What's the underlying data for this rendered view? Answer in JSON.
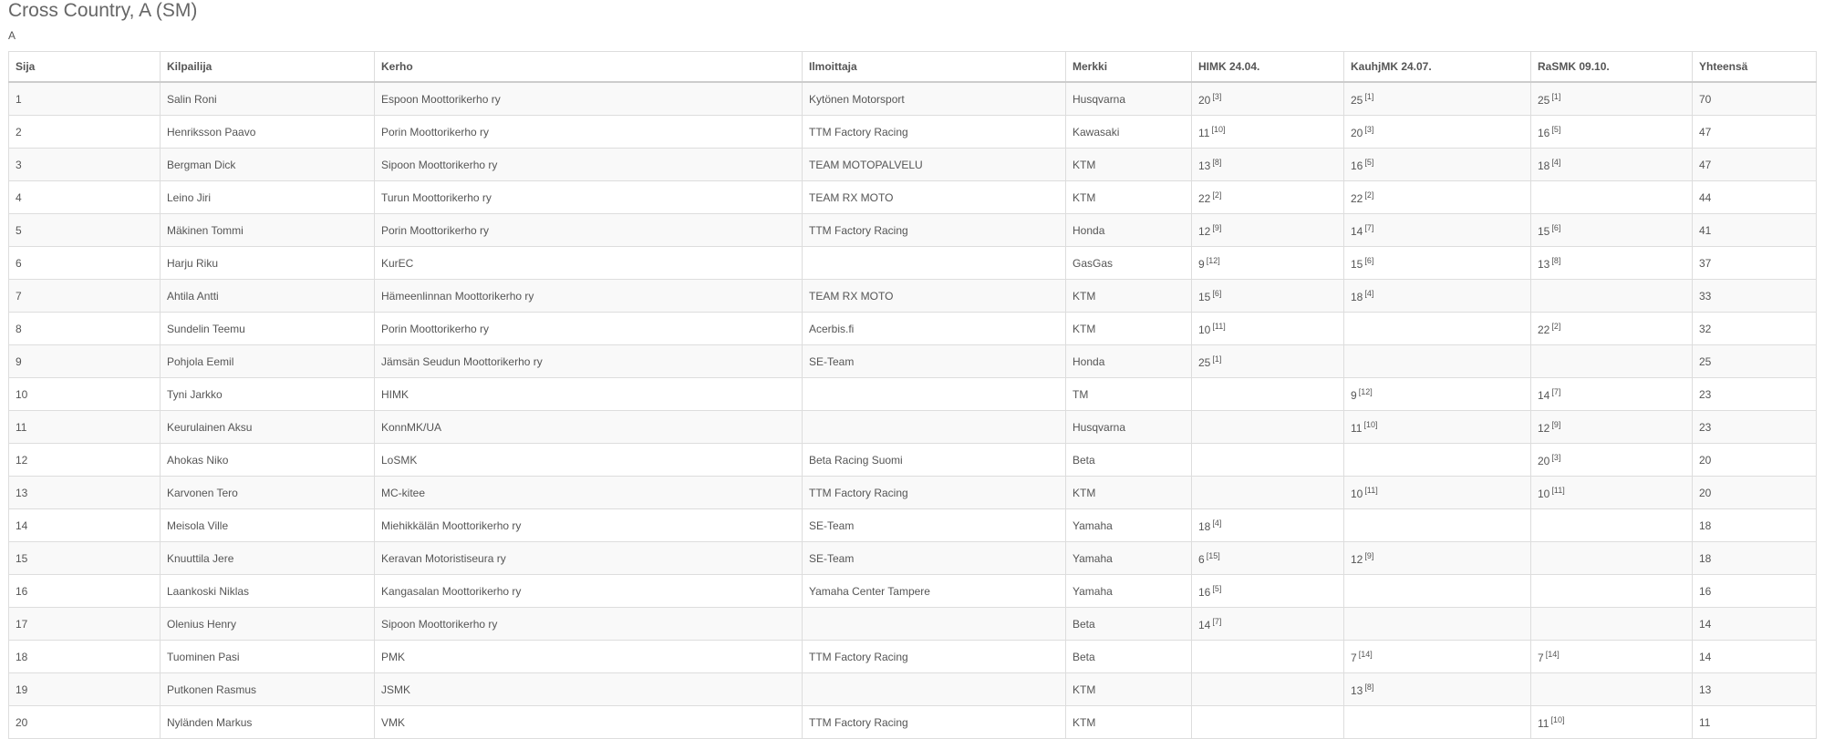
{
  "page": {
    "title": "Cross Country, A (SM)",
    "class_label": "A"
  },
  "table": {
    "headers": [
      "Sija",
      "Kilpailija",
      "Kerho",
      "Ilmoittaja",
      "Merkki",
      "HIMK 24.04.",
      "KauhjMK 24.07.",
      "RaSMK 09.10.",
      "Yhteensä"
    ],
    "rows": [
      {
        "rank": "1",
        "name": "Salin Roni",
        "club": "Espoon Moottorikerho ry",
        "entrant": "Kytönen Motorsport",
        "brand": "Husqvarna",
        "r1": {
          "pts": "20",
          "pos": "[3]"
        },
        "r2": {
          "pts": "25",
          "pos": "[1]"
        },
        "r3": {
          "pts": "25",
          "pos": "[1]"
        },
        "total": "70"
      },
      {
        "rank": "2",
        "name": "Henriksson Paavo",
        "club": "Porin Moottorikerho ry",
        "entrant": "TTM Factory Racing",
        "brand": "Kawasaki",
        "r1": {
          "pts": "11",
          "pos": "[10]"
        },
        "r2": {
          "pts": "20",
          "pos": "[3]"
        },
        "r3": {
          "pts": "16",
          "pos": "[5]"
        },
        "total": "47"
      },
      {
        "rank": "3",
        "name": "Bergman Dick",
        "club": "Sipoon Moottorikerho ry",
        "entrant": "TEAM MOTOPALVELU",
        "brand": "KTM",
        "r1": {
          "pts": "13",
          "pos": "[8]"
        },
        "r2": {
          "pts": "16",
          "pos": "[5]"
        },
        "r3": {
          "pts": "18",
          "pos": "[4]"
        },
        "total": "47"
      },
      {
        "rank": "4",
        "name": "Leino Jiri",
        "club": "Turun Moottorikerho ry",
        "entrant": "TEAM RX MOTO",
        "brand": "KTM",
        "r1": {
          "pts": "22",
          "pos": "[2]"
        },
        "r2": {
          "pts": "22",
          "pos": "[2]"
        },
        "r3": {
          "pts": "",
          "pos": ""
        },
        "total": "44"
      },
      {
        "rank": "5",
        "name": "Mäkinen Tommi",
        "club": "Porin Moottorikerho ry",
        "entrant": "TTM Factory Racing",
        "brand": "Honda",
        "r1": {
          "pts": "12",
          "pos": "[9]"
        },
        "r2": {
          "pts": "14",
          "pos": "[7]"
        },
        "r3": {
          "pts": "15",
          "pos": "[6]"
        },
        "total": "41"
      },
      {
        "rank": "6",
        "name": "Harju Riku",
        "club": "KurEC",
        "entrant": "",
        "brand": "GasGas",
        "r1": {
          "pts": "9",
          "pos": "[12]"
        },
        "r2": {
          "pts": "15",
          "pos": "[6]"
        },
        "r3": {
          "pts": "13",
          "pos": "[8]"
        },
        "total": "37"
      },
      {
        "rank": "7",
        "name": "Ahtila Antti",
        "club": "Hämeenlinnan Moottorikerho ry",
        "entrant": "TEAM RX MOTO",
        "brand": "KTM",
        "r1": {
          "pts": "15",
          "pos": "[6]"
        },
        "r2": {
          "pts": "18",
          "pos": "[4]"
        },
        "r3": {
          "pts": "",
          "pos": ""
        },
        "total": "33"
      },
      {
        "rank": "8",
        "name": "Sundelin Teemu",
        "club": "Porin Moottorikerho ry",
        "entrant": "Acerbis.fi",
        "brand": "KTM",
        "r1": {
          "pts": "10",
          "pos": "[11]"
        },
        "r2": {
          "pts": "",
          "pos": ""
        },
        "r3": {
          "pts": "22",
          "pos": "[2]"
        },
        "total": "32"
      },
      {
        "rank": "9",
        "name": "Pohjola Eemil",
        "club": "Jämsän Seudun Moottorikerho ry",
        "entrant": "SE-Team",
        "brand": "Honda",
        "r1": {
          "pts": "25",
          "pos": "[1]"
        },
        "r2": {
          "pts": "",
          "pos": ""
        },
        "r3": {
          "pts": "",
          "pos": ""
        },
        "total": "25"
      },
      {
        "rank": "10",
        "name": "Tyni Jarkko",
        "club": "HIMK",
        "entrant": "",
        "brand": "TM",
        "r1": {
          "pts": "",
          "pos": ""
        },
        "r2": {
          "pts": "9",
          "pos": "[12]"
        },
        "r3": {
          "pts": "14",
          "pos": "[7]"
        },
        "total": "23"
      },
      {
        "rank": "11",
        "name": "Keurulainen Aksu",
        "club": "KonnMK/UA",
        "entrant": "",
        "brand": "Husqvarna",
        "r1": {
          "pts": "",
          "pos": ""
        },
        "r2": {
          "pts": "11",
          "pos": "[10]"
        },
        "r3": {
          "pts": "12",
          "pos": "[9]"
        },
        "total": "23"
      },
      {
        "rank": "12",
        "name": "Ahokas Niko",
        "club": "LoSMK",
        "entrant": "Beta Racing Suomi",
        "brand": "Beta",
        "r1": {
          "pts": "",
          "pos": ""
        },
        "r2": {
          "pts": "",
          "pos": ""
        },
        "r3": {
          "pts": "20",
          "pos": "[3]"
        },
        "total": "20"
      },
      {
        "rank": "13",
        "name": "Karvonen Tero",
        "club": "MC-kitee",
        "entrant": "TTM Factory Racing",
        "brand": "KTM",
        "r1": {
          "pts": "",
          "pos": ""
        },
        "r2": {
          "pts": "10",
          "pos": "[11]"
        },
        "r3": {
          "pts": "10",
          "pos": "[11]"
        },
        "total": "20"
      },
      {
        "rank": "14",
        "name": "Meisola Ville",
        "club": "Miehikkälän Moottorikerho ry",
        "entrant": "SE-Team",
        "brand": "Yamaha",
        "r1": {
          "pts": "18",
          "pos": "[4]"
        },
        "r2": {
          "pts": "",
          "pos": ""
        },
        "r3": {
          "pts": "",
          "pos": ""
        },
        "total": "18"
      },
      {
        "rank": "15",
        "name": "Knuuttila Jere",
        "club": "Keravan Motoristiseura ry",
        "entrant": "SE-Team",
        "brand": "Yamaha",
        "r1": {
          "pts": "6",
          "pos": "[15]"
        },
        "r2": {
          "pts": "12",
          "pos": "[9]"
        },
        "r3": {
          "pts": "",
          "pos": ""
        },
        "total": "18"
      },
      {
        "rank": "16",
        "name": "Laankoski Niklas",
        "club": "Kangasalan Moottorikerho ry",
        "entrant": "Yamaha Center Tampere",
        "brand": "Yamaha",
        "r1": {
          "pts": "16",
          "pos": "[5]"
        },
        "r2": {
          "pts": "",
          "pos": ""
        },
        "r3": {
          "pts": "",
          "pos": ""
        },
        "total": "16"
      },
      {
        "rank": "17",
        "name": "Olenius Henry",
        "club": "Sipoon Moottorikerho ry",
        "entrant": "",
        "brand": "Beta",
        "r1": {
          "pts": "14",
          "pos": "[7]"
        },
        "r2": {
          "pts": "",
          "pos": ""
        },
        "r3": {
          "pts": "",
          "pos": ""
        },
        "total": "14"
      },
      {
        "rank": "18",
        "name": "Tuominen Pasi",
        "club": "PMK",
        "entrant": "TTM Factory Racing",
        "brand": "Beta",
        "r1": {
          "pts": "",
          "pos": ""
        },
        "r2": {
          "pts": "7",
          "pos": "[14]"
        },
        "r3": {
          "pts": "7",
          "pos": "[14]"
        },
        "total": "14"
      },
      {
        "rank": "19",
        "name": "Putkonen Rasmus",
        "club": "JSMK",
        "entrant": "",
        "brand": "KTM",
        "r1": {
          "pts": "",
          "pos": ""
        },
        "r2": {
          "pts": "13",
          "pos": "[8]"
        },
        "r3": {
          "pts": "",
          "pos": ""
        },
        "total": "13"
      },
      {
        "rank": "20",
        "name": "Nyländen Markus",
        "club": "VMK",
        "entrant": "TTM Factory Racing",
        "brand": "KTM",
        "r1": {
          "pts": "",
          "pos": ""
        },
        "r2": {
          "pts": "",
          "pos": ""
        },
        "r3": {
          "pts": "11",
          "pos": "[10]"
        },
        "total": "11"
      }
    ]
  }
}
